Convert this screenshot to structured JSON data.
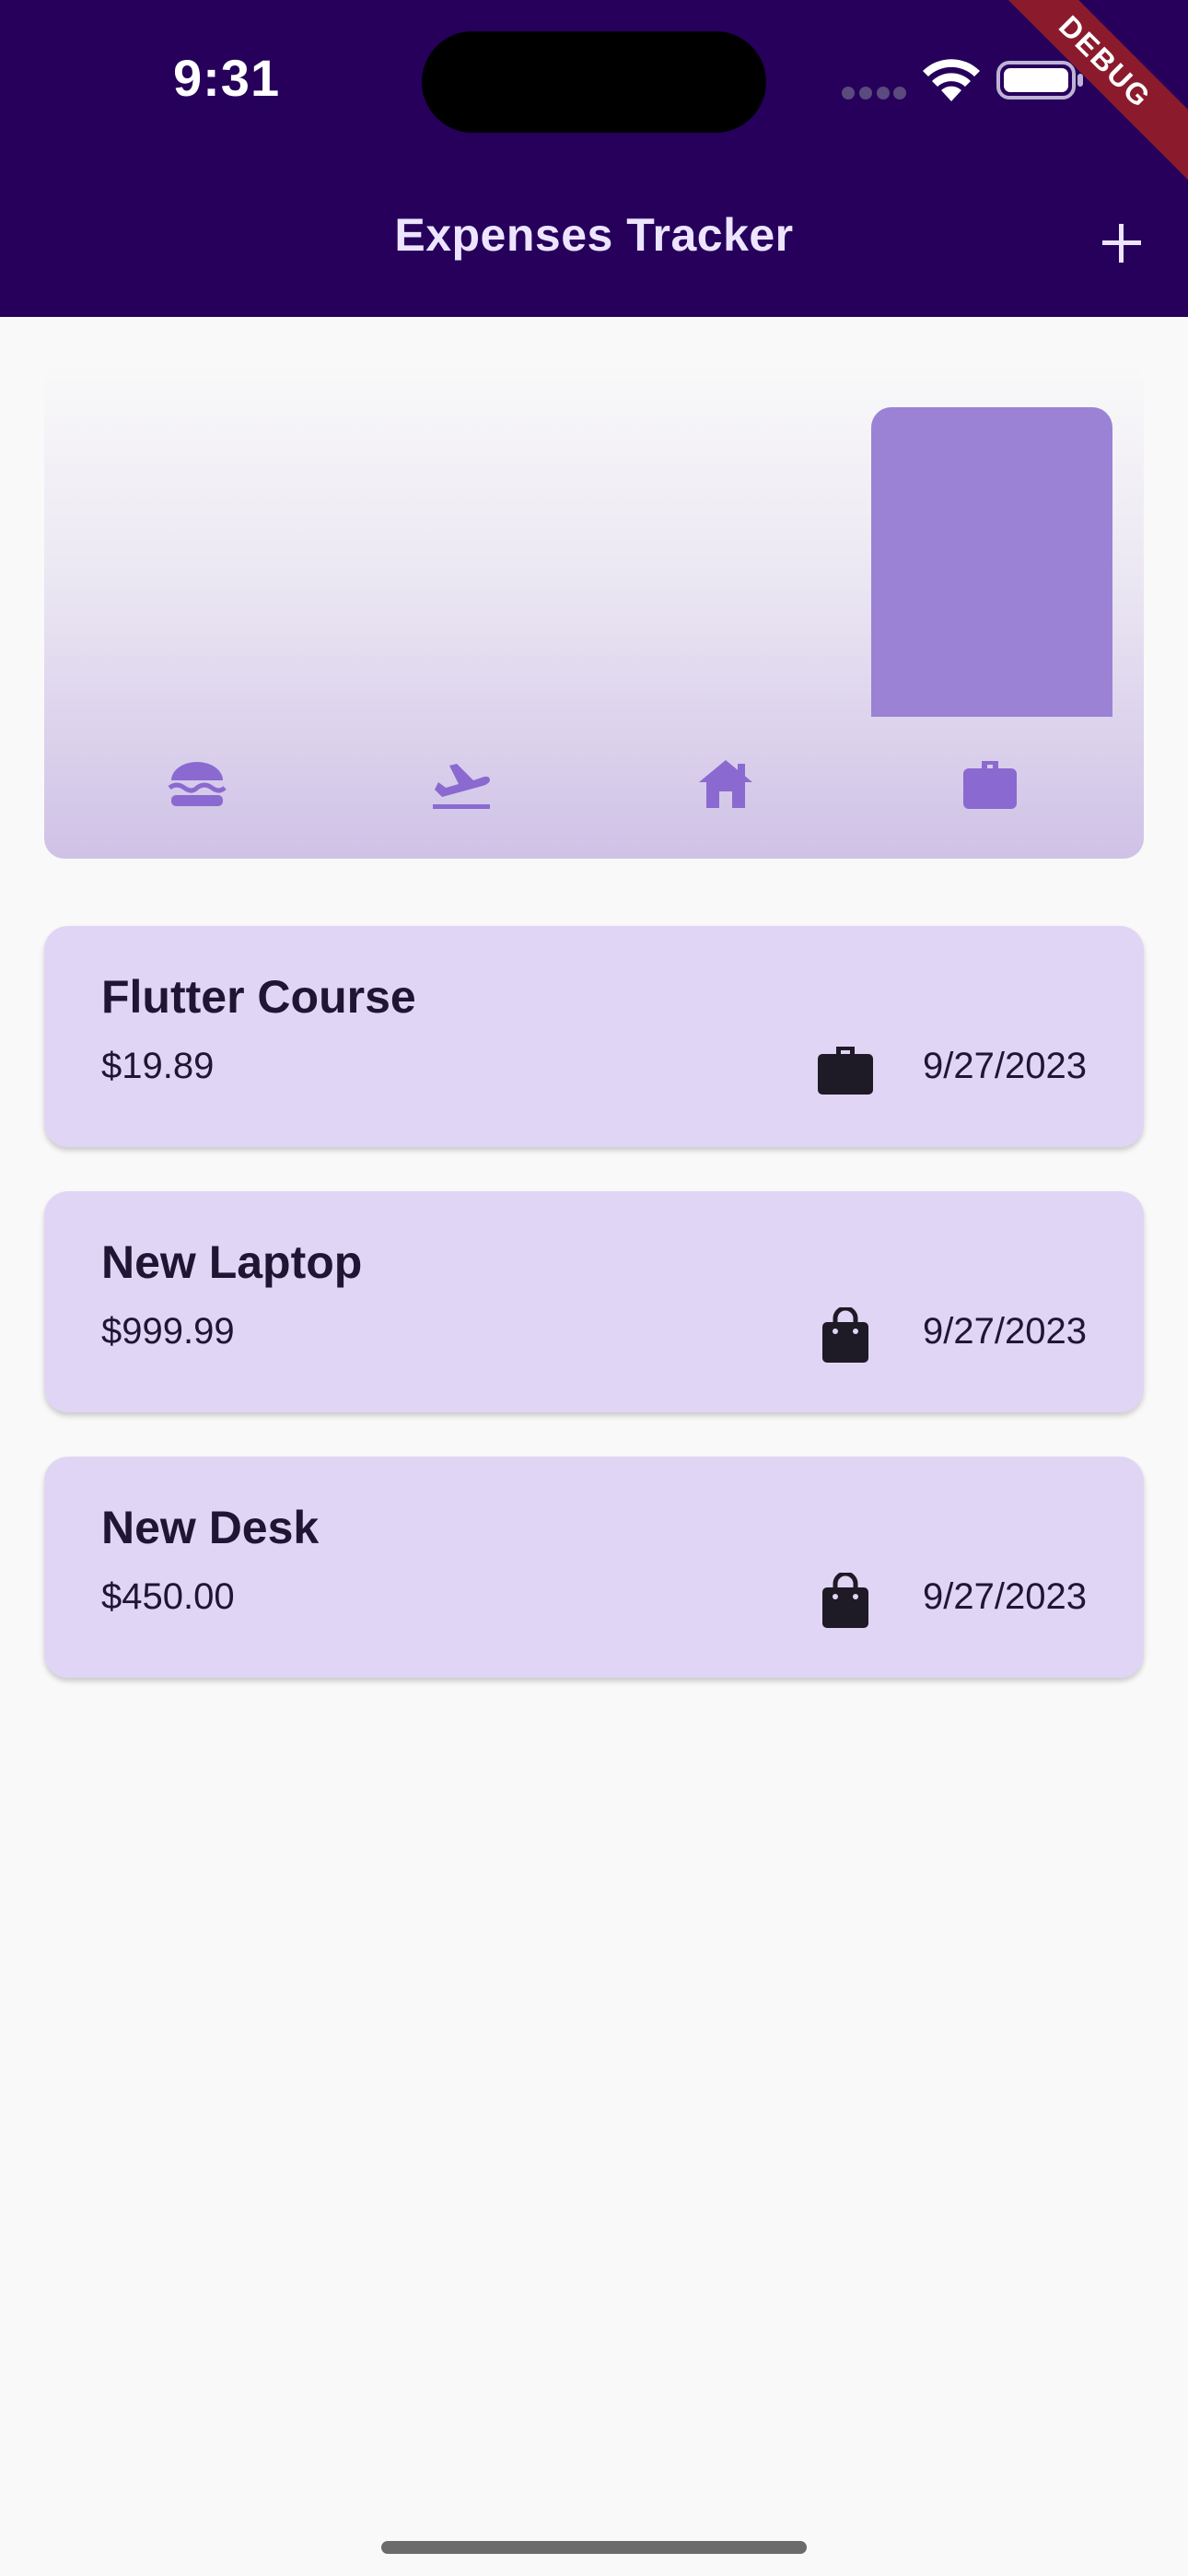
{
  "status_bar": {
    "time": "9:31"
  },
  "debug_banner": "DEBUG",
  "app_bar": {
    "title": "Expenses Tracker",
    "add_icon": "plus-icon"
  },
  "colors": {
    "app_bar_bg": "#26005b",
    "bar_fill": "#9b82d5",
    "card_bg": "#e1d5f5",
    "category_icon": "#8a6ad0"
  },
  "chart_data": {
    "type": "bar",
    "categories": [
      "food",
      "travel",
      "leisure",
      "work"
    ],
    "category_icons": [
      "burger-icon",
      "flight-takeoff-icon",
      "house-icon",
      "briefcase-icon"
    ],
    "values": [
      0,
      0,
      0,
      1
    ],
    "ylim": [
      0,
      1
    ]
  },
  "expenses": [
    {
      "title": "Flutter Course",
      "amount": "$19.89",
      "date": "9/27/2023",
      "icon": "briefcase-icon"
    },
    {
      "title": "New Laptop",
      "amount": "$999.99",
      "date": "9/27/2023",
      "icon": "shopping-bag-icon"
    },
    {
      "title": "New Desk",
      "amount": "$450.00",
      "date": "9/27/2023",
      "icon": "shopping-bag-icon"
    }
  ]
}
